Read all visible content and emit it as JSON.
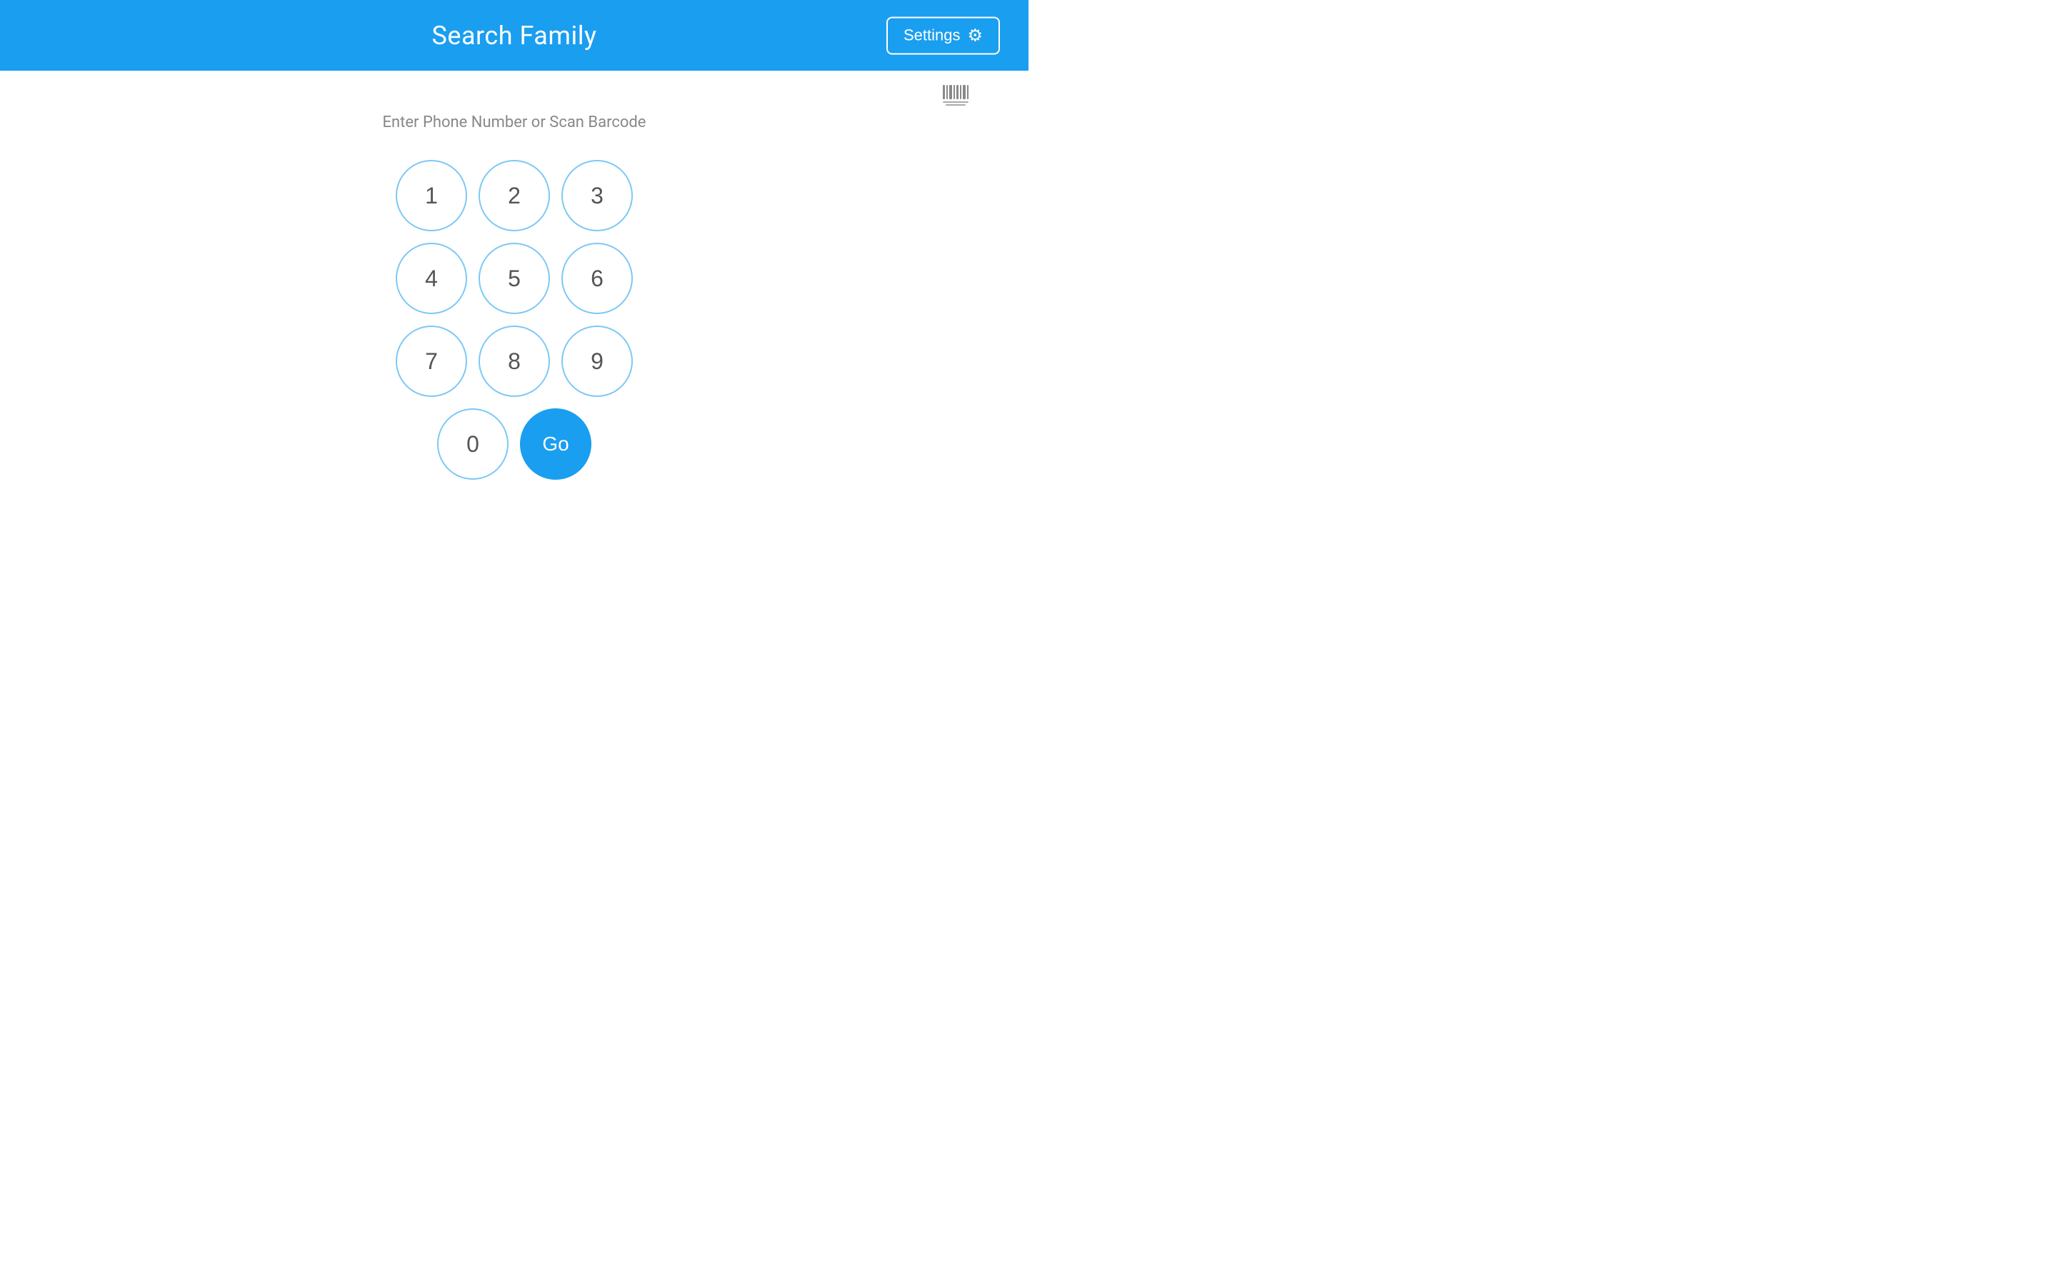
{
  "header": {
    "title": "Search Family",
    "settings_label": "Settings"
  },
  "main": {
    "instruction": "Enter Phone Number or Scan Barcode"
  },
  "keypad": {
    "rows": [
      [
        "1",
        "2",
        "3"
      ],
      [
        "4",
        "5",
        "6"
      ],
      [
        "7",
        "8",
        "9"
      ],
      [
        "0"
      ]
    ],
    "go_label": "Go"
  }
}
